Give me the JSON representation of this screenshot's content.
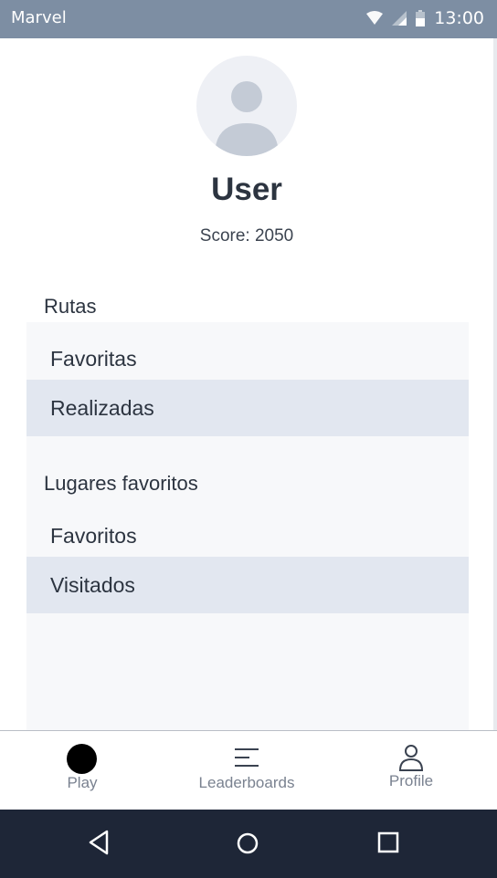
{
  "status_bar": {
    "app_name": "Marvel",
    "time": "13:00"
  },
  "profile": {
    "username": "User",
    "score_text": "Score: 2050"
  },
  "sections": [
    {
      "title": "Rutas",
      "items": [
        "Favoritas",
        "Realizadas"
      ]
    },
    {
      "title": "Lugares favoritos",
      "items": [
        "Favoritos",
        "Visitados"
      ]
    }
  ],
  "bottom_nav": {
    "tabs": [
      {
        "label": "Play",
        "icon": "play-dot-icon"
      },
      {
        "label": "Leaderboards",
        "icon": "leaderboard-icon"
      },
      {
        "label": "Profile",
        "icon": "person-icon"
      }
    ]
  },
  "colors": {
    "status_bar": "#7d8ea3",
    "item_highlight": "#e2e7f0",
    "system_nav": "#1e2637"
  }
}
